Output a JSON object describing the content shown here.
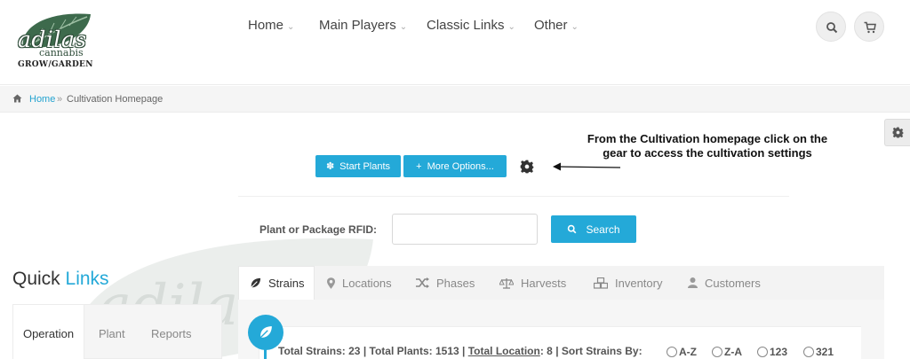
{
  "brand": {
    "logo_main": "adilas",
    "logo_sub": "cannabis",
    "logo_tag": "GROW/GARDEN",
    "green": "#2f4d3a"
  },
  "nav": {
    "items": [
      {
        "label": "Home"
      },
      {
        "label": "Main Players"
      },
      {
        "label": "Classic Links"
      },
      {
        "label": "Other"
      }
    ],
    "chevron": "⌄"
  },
  "header_icons": [
    "search-icon",
    "cart-icon"
  ],
  "breadcrumb": {
    "home": "Home",
    "separator": "»",
    "current": "Cultivation Homepage"
  },
  "actions": {
    "start_plants": "Start Plants",
    "more_options": "More Options...",
    "accent": "#24a9d8"
  },
  "annotation": {
    "line1": "From the Cultivation homepage click on the",
    "line2": "gear to access the cultivation settings"
  },
  "search": {
    "label": "Plant or Package RFID:",
    "value": "",
    "placeholder": "",
    "button": "Search"
  },
  "quick_links": {
    "title_plain": "Quick",
    "title_accent": "Links",
    "tabs": [
      {
        "label": "Operation",
        "active": true
      },
      {
        "label": "Plant",
        "active": false
      },
      {
        "label": "Reports",
        "active": false
      }
    ]
  },
  "main_tabs": [
    {
      "label": "Strains",
      "icon": "leaf-icon",
      "active": true
    },
    {
      "label": "Locations",
      "icon": "map-pin-icon",
      "active": false
    },
    {
      "label": "Phases",
      "icon": "shuffle-icon",
      "active": false
    },
    {
      "label": "Harvests",
      "icon": "scale-icon",
      "active": false
    },
    {
      "label": "Inventory",
      "icon": "cubes-icon",
      "active": false
    },
    {
      "label": "Customers",
      "icon": "user-icon",
      "active": false
    }
  ],
  "strains_panel": {
    "total_strains": "Total Strains: 23",
    "sep": "|",
    "total_plants": "Total Plants: 1513",
    "total_location": "Total Location",
    "total_location_value": ": 8",
    "sort_label": "Sort Strains By:",
    "sort_options": [
      "A-Z",
      "Z-A",
      "123",
      "321"
    ]
  }
}
